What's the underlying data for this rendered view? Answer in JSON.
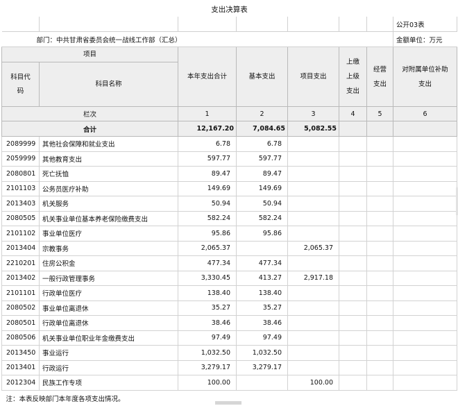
{
  "title": "支出决算表",
  "form_code": "公开03表",
  "department": "部门：中共甘肃省委员会统一战线工作部（汇总）",
  "unit": "金额单位：万元",
  "headers": {
    "item": "项目",
    "code": "科目代码",
    "name": "科目名称",
    "total": "本年支出合计",
    "basic": "基本支出",
    "project": "项目支出",
    "upper": "上缴上级支出",
    "business": "经营支出",
    "subsidy": "对附属单位补助支出"
  },
  "seq": {
    "label": "栏次",
    "cols": [
      "1",
      "2",
      "3",
      "4",
      "5",
      "6"
    ]
  },
  "total_row": {
    "label": "合计",
    "total": "12,167.20",
    "basic": "7,084.65",
    "project": "5,082.55"
  },
  "rows": [
    {
      "code": "2089999",
      "name": "其他社会保障和就业支出",
      "total": "6.78",
      "basic": "6.78",
      "project": ""
    },
    {
      "code": "2059999",
      "name": "其他教育支出",
      "total": "597.77",
      "basic": "597.77",
      "project": ""
    },
    {
      "code": "2080801",
      "name": "死亡抚恤",
      "total": "89.47",
      "basic": "89.47",
      "project": ""
    },
    {
      "code": "2101103",
      "name": "公务员医疗补助",
      "total": "149.69",
      "basic": "149.69",
      "project": ""
    },
    {
      "code": "2013403",
      "name": "机关服务",
      "total": "50.94",
      "basic": "50.94",
      "project": ""
    },
    {
      "code": "2080505",
      "name": "机关事业单位基本养老保险缴费支出",
      "total": "582.24",
      "basic": "582.24",
      "project": ""
    },
    {
      "code": "2101102",
      "name": "事业单位医疗",
      "total": "95.86",
      "basic": "95.86",
      "project": ""
    },
    {
      "code": "2013404",
      "name": "宗教事务",
      "total": "2,065.37",
      "basic": "",
      "project": "2,065.37"
    },
    {
      "code": "2210201",
      "name": "住房公积金",
      "total": "477.34",
      "basic": "477.34",
      "project": ""
    },
    {
      "code": "2013402",
      "name": "一般行政管理事务",
      "total": "3,330.45",
      "basic": "413.27",
      "project": "2,917.18"
    },
    {
      "code": "2101101",
      "name": "行政单位医疗",
      "total": "138.40",
      "basic": "138.40",
      "project": ""
    },
    {
      "code": "2080502",
      "name": "事业单位离退休",
      "total": "35.27",
      "basic": "35.27",
      "project": ""
    },
    {
      "code": "2080501",
      "name": "行政单位离退休",
      "total": "38.46",
      "basic": "38.46",
      "project": ""
    },
    {
      "code": "2080506",
      "name": "机关事业单位职业年金缴费支出",
      "total": "97.49",
      "basic": "97.49",
      "project": ""
    },
    {
      "code": "2013450",
      "name": "事业运行",
      "total": "1,032.50",
      "basic": "1,032.50",
      "project": ""
    },
    {
      "code": "2013401",
      "name": "行政运行",
      "total": "3,279.17",
      "basic": "3,279.17",
      "project": ""
    },
    {
      "code": "2012304",
      "name": "民族工作专项",
      "total": "100.00",
      "basic": "",
      "project": "100.00"
    }
  ],
  "note": "注：本表反映部门本年度各项支出情况。"
}
